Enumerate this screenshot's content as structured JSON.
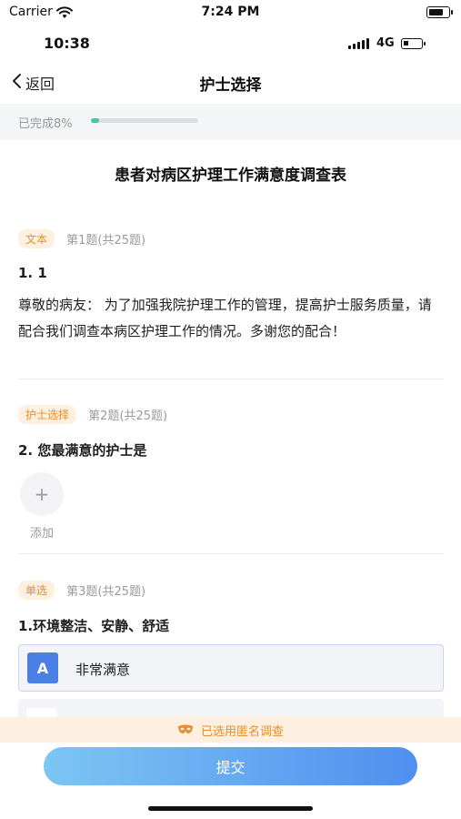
{
  "sim_status": {
    "carrier": "Carrier",
    "time": "7:24 PM"
  },
  "device_status": {
    "time": "10:38",
    "network": "4G"
  },
  "navbar": {
    "back_label": "返回",
    "title": "护士选择"
  },
  "progress": {
    "label": "已完成8%",
    "percent": 8
  },
  "survey": {
    "title": "患者对病区护理工作满意度调查表"
  },
  "questions": [
    {
      "tag": "文本",
      "meta": "第1题(共25题)",
      "title": "1. 1",
      "body": "尊敬的病友： 为了加强我院护理工作的管理，提高护士服务质量，请配合我们调查本病区护理工作的情况。多谢您的配合！"
    },
    {
      "tag": "护士选择",
      "meta": "第2题(共25题)",
      "title": "2. 您最满意的护士是",
      "add_label": "添加"
    },
    {
      "tag": "单选",
      "meta": "第3题(共25题)",
      "title": "1.环境整洁、安静、舒适",
      "options": [
        {
          "letter": "A",
          "text": "非常满意"
        }
      ]
    }
  ],
  "anonymous": {
    "label": "已选用匿名调查"
  },
  "submit": {
    "label": "提交"
  },
  "colors": {
    "accent_blue": "#4a7fe6",
    "tag_orange": "#e6902c",
    "tag_bg": "#fdf0e0",
    "progress_green": "#4cc3a3"
  },
  "icons": {
    "back": "chevron-left-icon",
    "add": "plus-icon",
    "anonymous": "mask-icon",
    "wifi": "wifi-icon",
    "signal": "signal-icon",
    "battery": "battery-icon"
  }
}
